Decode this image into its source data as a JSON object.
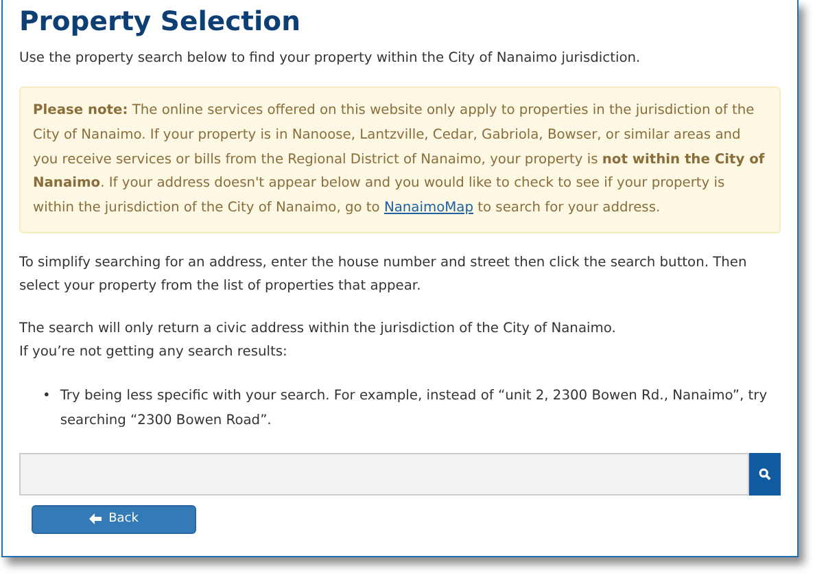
{
  "title": "Property Selection",
  "intro": "Use the property search below to find your property within the City of Nanaimo jurisdiction.",
  "note": {
    "text_before": "**Please note:** The online services offered on this website only apply to properties in the jurisdiction of the City of Nanaimo. If your property is in Nanoose, Lantzville, Cedar, Gabriola, Bowser, or similar areas and you receive services or bills from the Regional District of Nanaimo, your property is **not within the City of Nanaimo**. If your address doesn't appear below and you would like to check to see if your property is within the jurisdiction of the City of Nanaimo, go to ",
    "link": "NanaimoMap",
    "text_after": " to search for your address."
  },
  "paragraphs": [
    "To simplify searching for an address, enter the house number and street then click the search button. Then select your property from the list of properties that appear.",
    "The search will only return a civic address within the jurisdiction of the City of Nanaimo.\nIf you’re not getting any search results:"
  ],
  "bullet_marker": "•",
  "bullets": [
    "Try being less specific with your search. For example, instead of “unit 2, 2300 Bowen Rd., Nanaimo”, try searching “2300 Bowen Road”."
  ],
  "back_button": "Back"
}
